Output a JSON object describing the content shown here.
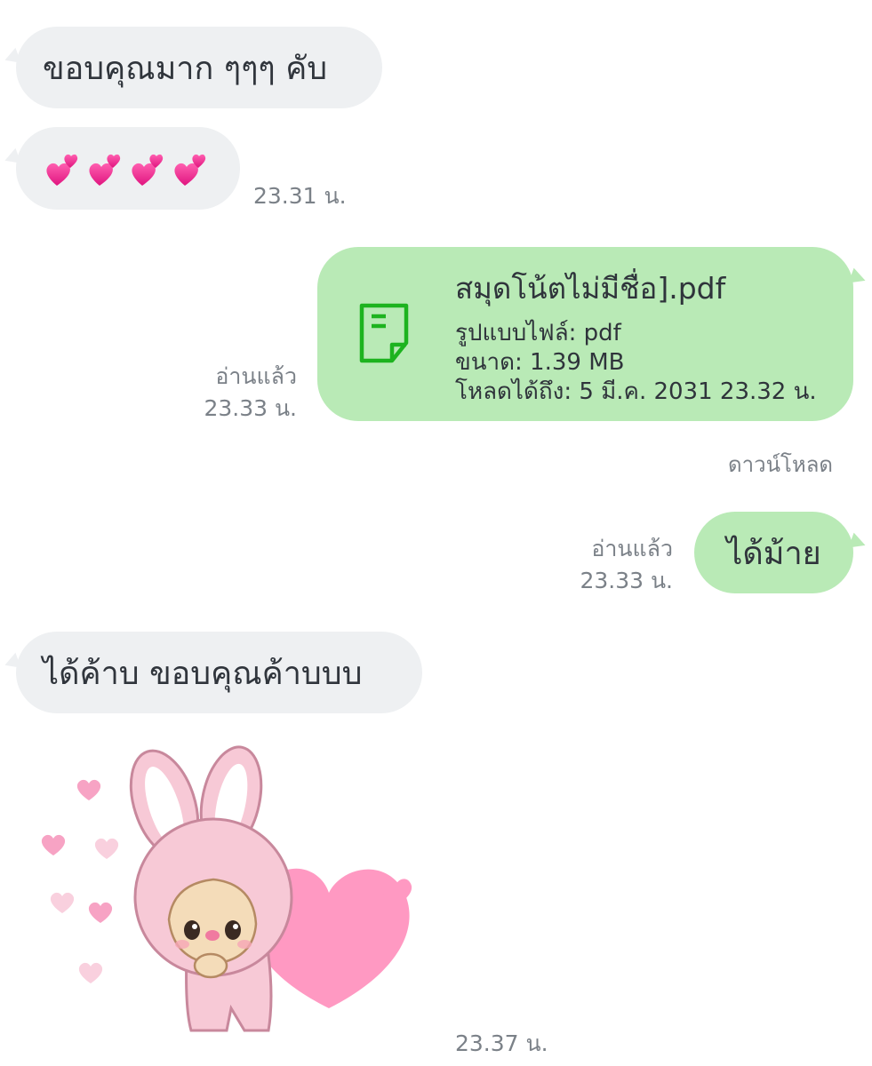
{
  "messages": {
    "m1": {
      "text": "ขอบคุณมาก ๆๆๆ คับ"
    },
    "m2": {
      "emoji_icon": "two-hearts-icon x4",
      "time": "23.31 น."
    },
    "m3": {
      "file_name": "สมุดโน้ตไม่มีชื่อ].pdf",
      "format": "รูปแบบไฟล์: pdf",
      "size": "ขนาด: 1.39 MB",
      "expiry": "โหลดได้ถึง: 5 มี.ค. 2031 23.32 น.",
      "read": "อ่านแล้ว",
      "time": "23.33 น.",
      "download_label": "ดาวน์โหลด"
    },
    "m4": {
      "text": "ได้ม้าย",
      "read": "อ่านแล้ว",
      "time": "23.33 น."
    },
    "m5": {
      "text": "ได้ค้าบ ขอบคุณค้าบบบ"
    },
    "m6": {
      "sticker": "pink-bunny-monchhichi-sticker",
      "time": "23.37 น."
    }
  },
  "colors": {
    "incoming_bubble": "#eef0f2",
    "outgoing_bubble": "#b9eab6",
    "file_icon": "#1db31f",
    "meta_text": "#7b8188",
    "heart_pink": "#f08bb8"
  }
}
